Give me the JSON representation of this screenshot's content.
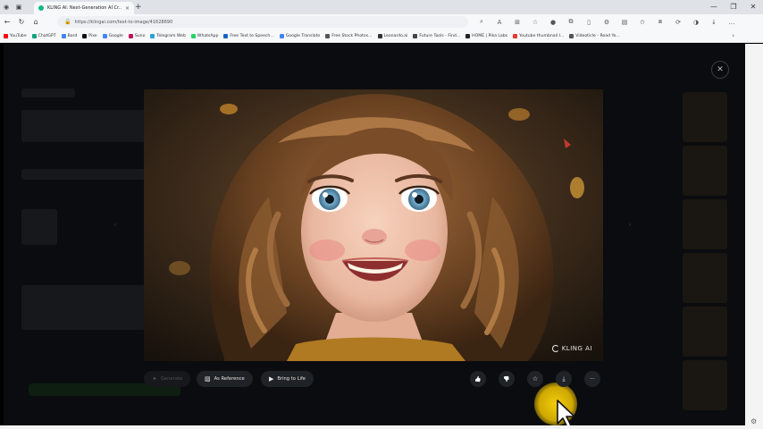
{
  "browser": {
    "tab_title": "KLING AI: Next-Generation AI Cr...",
    "tab_close": "×",
    "new_tab": "+",
    "url": "https://klingai.com/text-to-image/41628690",
    "window_controls": [
      "—",
      "❐",
      "✕"
    ],
    "bookmarks": [
      {
        "label": "YouTube",
        "color": "#ff0000"
      },
      {
        "label": "ChatGPT",
        "color": "#10a37f"
      },
      {
        "label": "Bard",
        "color": "#4285f4"
      },
      {
        "label": "Pixe",
        "color": "#111111"
      },
      {
        "label": "Google",
        "color": "#4285f4"
      },
      {
        "label": "Suno",
        "color": "#c0165c"
      },
      {
        "label": "Telegram Web",
        "color": "#2aa1da"
      },
      {
        "label": "WhatsApp",
        "color": "#25d366"
      },
      {
        "label": "Free Text to Speech...",
        "color": "#1565c0"
      },
      {
        "label": "Google Translate",
        "color": "#4285f4"
      },
      {
        "label": "Free Stock Photos...",
        "color": "#555555"
      },
      {
        "label": "Leonardo.ai",
        "color": "#333333"
      },
      {
        "label": "Future Tools - Find...",
        "color": "#444444"
      },
      {
        "label": "HOME | Pika Labs",
        "color": "#222222"
      },
      {
        "label": "Youtube thumbnail l...",
        "color": "#e53935"
      },
      {
        "label": "Videoticle - Read Yo...",
        "color": "#555555"
      }
    ],
    "bookmarks_more": "›"
  },
  "viewer": {
    "close": "✕",
    "prev": "‹",
    "next": "›",
    "watermark": "KLING AI"
  },
  "actions": {
    "generate_label": "Generate",
    "reference_label": "As Reference",
    "bring_to_life_label": "Bring to Life"
  },
  "icons": {
    "like": "👍",
    "dislike": "👎",
    "favorite": "☆",
    "download": "⤓",
    "more": "···"
  }
}
